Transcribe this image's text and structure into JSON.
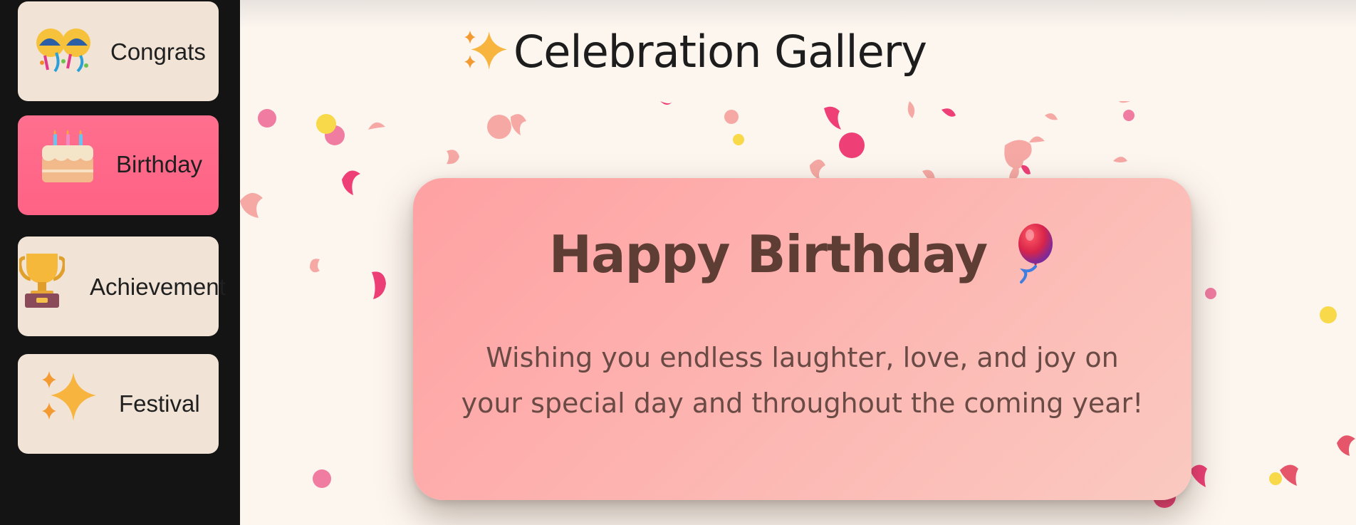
{
  "sidebar": {
    "items": [
      {
        "label": "Congrats",
        "icon": "party-popper-face-icon",
        "active": false
      },
      {
        "label": "Birthday",
        "icon": "birthday-cake-icon",
        "active": true
      },
      {
        "label": "Achievement",
        "icon": "trophy-icon",
        "active": false
      },
      {
        "label": "Festival",
        "icon": "sparkles-icon",
        "active": false
      }
    ]
  },
  "header": {
    "title": "Celebration Gallery",
    "title_icon": "sparkles-icon"
  },
  "card": {
    "title": "Happy Birthday",
    "title_icon": "balloon-icon",
    "message": "Wishing you endless laughter, love, and joy on your special day and throughout the coming year!"
  },
  "colors": {
    "sidebar_bg": "#141414",
    "nav_card_bg": "#f1e4d6",
    "nav_card_active": "#ff6b8b",
    "page_bg": "#fdf6ef",
    "card_gradient_start": "#ffa1a3",
    "card_gradient_end": "#fac9c0",
    "card_title": "#5e3d34",
    "confetti_pink": "#f0487a",
    "confetti_light": "#f7b3ac",
    "confetti_yellow": "#f6d84a"
  }
}
